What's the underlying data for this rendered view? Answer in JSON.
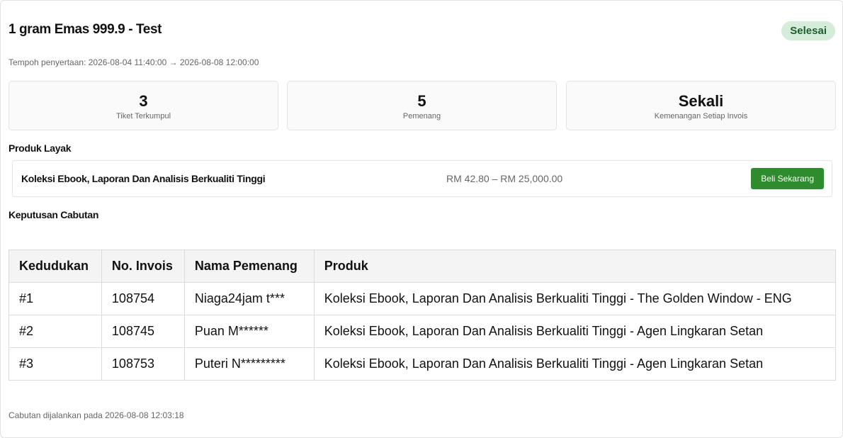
{
  "header": {
    "title": "1 gram Emas 999.9 - Test",
    "status": "Selesai",
    "period": "Tempoh penyertaan: 2026-08-04 11:40:00 → 2026-08-08 12:00:00"
  },
  "stats": [
    {
      "value": "3",
      "label": "Tiket Terkumpul"
    },
    {
      "value": "5",
      "label": "Pemenang"
    },
    {
      "value": "Sekali",
      "label": "Kemenangan Setiap Invois"
    }
  ],
  "eligible": {
    "heading": "Produk Layak",
    "product_name": "Koleksi Ebook, Laporan Dan Analisis Berkualiti Tinggi",
    "price_range": "RM 42.80 – RM 25,000.00",
    "buy_label": "Beli Sekarang"
  },
  "results": {
    "heading": "Keputusan Cabutan",
    "columns": [
      "Kedudukan",
      "No. Invois",
      "Nama Pemenang",
      "Produk"
    ],
    "rows": [
      [
        "#1",
        "108754",
        "Niaga24jam t***",
        "Koleksi Ebook, Laporan Dan Analisis Berkualiti Tinggi - The Golden Window - ENG"
      ],
      [
        "#2",
        "108745",
        "Puan M******",
        "Koleksi Ebook, Laporan Dan Analisis Berkualiti Tinggi - Agen Lingkaran Setan"
      ],
      [
        "#3",
        "108753",
        "Puteri N*********",
        "Koleksi Ebook, Laporan Dan Analisis Berkualiti Tinggi - Agen Lingkaran Setan"
      ]
    ]
  },
  "footer": {
    "note": "Cabutan dijalankan pada 2026-08-08 12:03:18"
  },
  "colors": {
    "status_bg": "#d4ecd9",
    "status_text": "#1d5e2f",
    "buy_button": "#2e8b2e"
  }
}
